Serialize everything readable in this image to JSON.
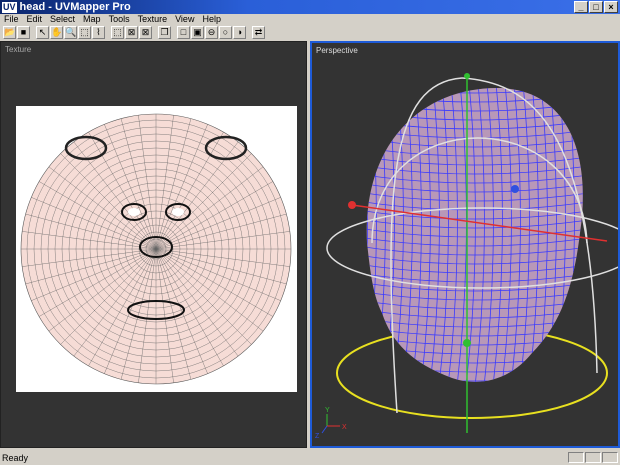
{
  "window": {
    "title": "head - UVMapper Pro",
    "icon_text": "UV",
    "minimize": "_",
    "maximize": "□",
    "close": "×"
  },
  "menu": [
    "File",
    "Edit",
    "Select",
    "Map",
    "Tools",
    "Texture",
    "View",
    "Help"
  ],
  "toolbar": [
    {
      "name": "open-icon",
      "glyph": "📂"
    },
    {
      "name": "save-icon",
      "glyph": "■"
    },
    {
      "sep": true
    },
    {
      "name": "select-arrow-icon",
      "glyph": "↖"
    },
    {
      "name": "pan-hand-icon",
      "glyph": "✋"
    },
    {
      "name": "zoom-icon",
      "glyph": "🔍"
    },
    {
      "name": "marquee-icon",
      "glyph": "⬚"
    },
    {
      "name": "lasso-icon",
      "glyph": "⌇"
    },
    {
      "sep": true
    },
    {
      "name": "select-vertices-icon",
      "glyph": "⬚"
    },
    {
      "name": "select-edges-icon",
      "glyph": "⊠"
    },
    {
      "name": "select-faces-icon",
      "glyph": "⊠"
    },
    {
      "sep": true
    },
    {
      "name": "copy-icon",
      "glyph": "❐"
    },
    {
      "sep": true
    },
    {
      "name": "box-map-icon",
      "glyph": "□"
    },
    {
      "name": "cylinder-map-icon",
      "glyph": "▣"
    },
    {
      "name": "sphere-map-icon",
      "glyph": "⊖"
    },
    {
      "name": "circle-map-icon",
      "glyph": "○"
    },
    {
      "name": "polar-map-icon",
      "glyph": "◑"
    },
    {
      "sep": true
    },
    {
      "name": "refresh-icon",
      "glyph": "⇄"
    }
  ],
  "panels": {
    "texture": "Texture",
    "perspective": "Perspective"
  },
  "axes": {
    "x": "X",
    "y": "Y",
    "z": "Z"
  },
  "status": "Ready",
  "colors": {
    "viewport_bg": "#333333",
    "active_border": "#1e5bd8",
    "mesh": "#3a3aff",
    "gimbal": "#e0e0e0",
    "ground_ring": "#e8e020"
  }
}
